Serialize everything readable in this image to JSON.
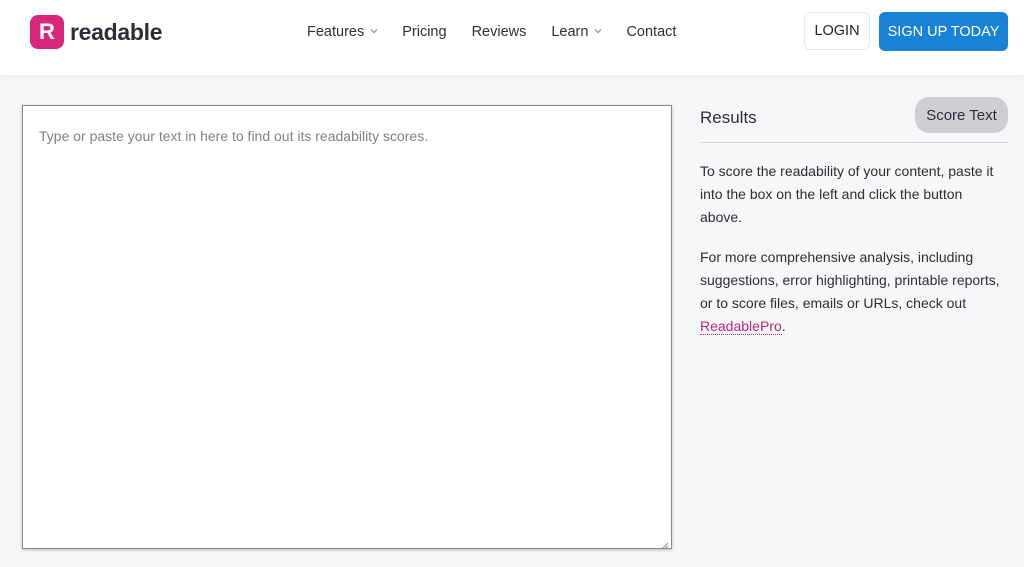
{
  "header": {
    "logo_letter": "R",
    "logo_text": "readable",
    "nav": [
      {
        "label": "Features",
        "has_dropdown": true
      },
      {
        "label": "Pricing",
        "has_dropdown": false
      },
      {
        "label": "Reviews",
        "has_dropdown": false
      },
      {
        "label": "Learn",
        "has_dropdown": true
      },
      {
        "label": "Contact",
        "has_dropdown": false
      }
    ],
    "login_label": "LOGIN",
    "signup_label": "SIGN UP TODAY"
  },
  "editor": {
    "placeholder": "Type or paste your text in here to find out its readability scores.",
    "value": ""
  },
  "results": {
    "title": "Results",
    "score_button": "Score Text",
    "paragraph1": "To score the readability of your content, paste it into the box on the left and click the button above.",
    "paragraph2_text": "For more comprehensive analysis, including suggestions, error highlighting, printable reports, or to score files, emails or URLs, check out ",
    "paragraph2_link": "ReadablePro",
    "paragraph2_end": "."
  },
  "colors": {
    "brand": "#d6277d",
    "primary_button": "#1782d6",
    "link": "#b32b74"
  },
  "icons": [
    "chevron-down-icon",
    "resize-grip-icon"
  ]
}
